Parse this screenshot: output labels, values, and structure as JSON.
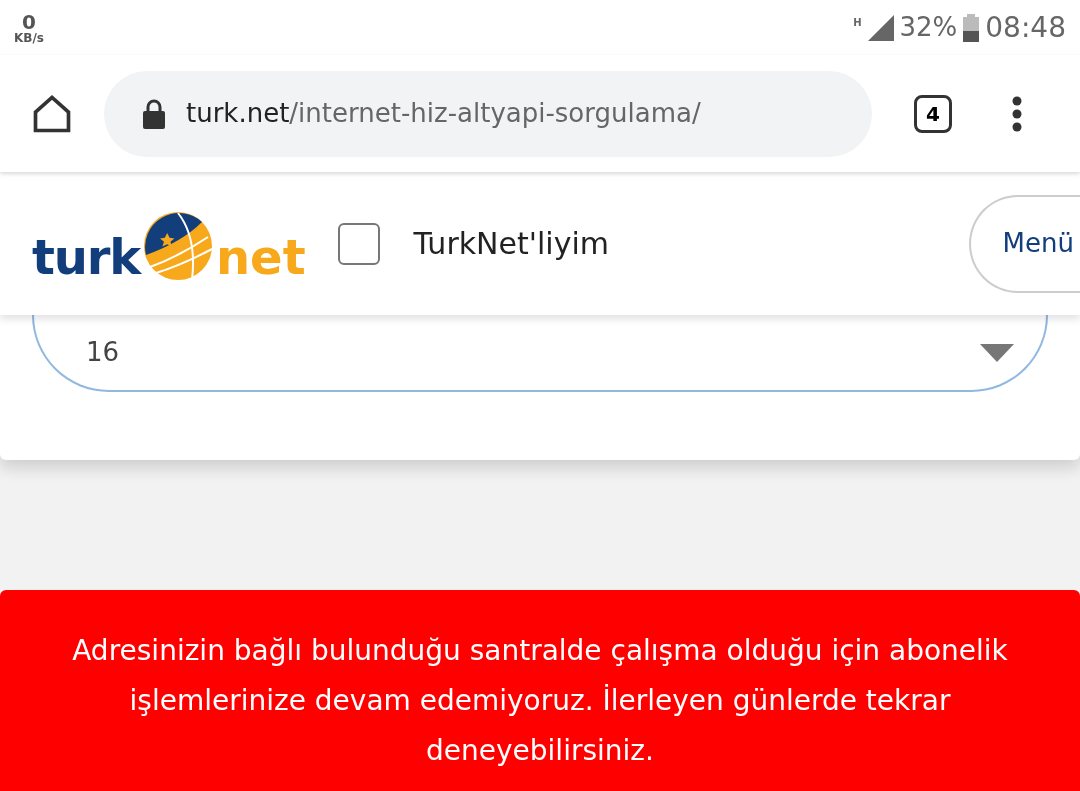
{
  "status_bar": {
    "speed_value": "0",
    "speed_unit": "KB/s",
    "network": "H",
    "battery": "32%",
    "time": "08:48"
  },
  "browser": {
    "url_domain": "turk.net",
    "url_path": "/internet-hiz-altyapi-sorgulama/",
    "tab_count": "4"
  },
  "site_header": {
    "logo_left": "turk",
    "logo_right": "net",
    "checkbox": {
      "label": "TurkNet'liyim",
      "checked": false
    },
    "menu_button": "Menü"
  },
  "select": {
    "value": "16"
  },
  "alert": {
    "message": "Adresinizin bağlı bulunduğu santralde çalışma olduğu için abonelik işlemlerinize devam edemiyoruz. İlerleyen günlerde tekrar deneyebilirsiniz."
  }
}
